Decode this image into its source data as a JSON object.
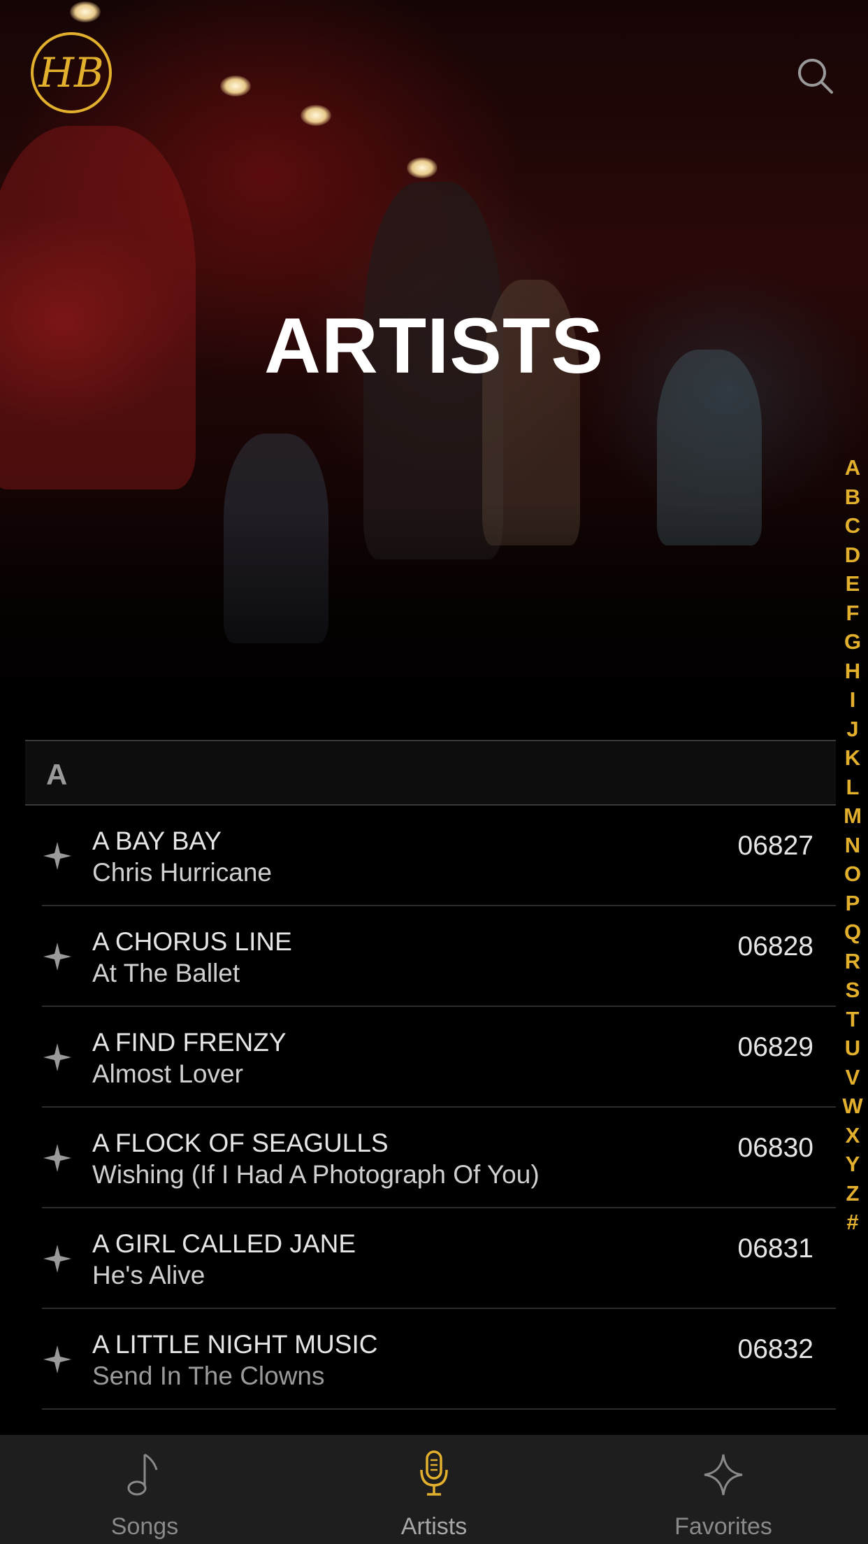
{
  "header": {
    "logo_text": "HB",
    "title": "ARTISTS"
  },
  "section": {
    "letter": "A"
  },
  "rows": [
    {
      "artist": "A BAY BAY",
      "song": "Chris Hurricane",
      "number": "06827"
    },
    {
      "artist": "A CHORUS LINE",
      "song": "At The Ballet",
      "number": "06828"
    },
    {
      "artist": "A FIND FRENZY",
      "song": "Almost Lover",
      "number": "06829"
    },
    {
      "artist": "A FLOCK OF SEAGULLS",
      "song": "Wishing (If I Had A Photograph Of You)",
      "number": "06830"
    },
    {
      "artist": "A GIRL CALLED JANE",
      "song": "He's Alive",
      "number": "06831"
    },
    {
      "artist": "A LITTLE NIGHT MUSIC",
      "song": "Send In The Clowns",
      "number": "06832"
    }
  ],
  "alphabet": [
    "A",
    "B",
    "C",
    "D",
    "E",
    "F",
    "G",
    "H",
    "I",
    "J",
    "K",
    "L",
    "M",
    "N",
    "O",
    "P",
    "Q",
    "R",
    "S",
    "T",
    "U",
    "V",
    "W",
    "X",
    "Y",
    "Z",
    "#"
  ],
  "tabs": [
    {
      "label": "Songs",
      "icon": "music-note-icon",
      "active": false
    },
    {
      "label": "Artists",
      "icon": "microphone-icon",
      "active": true
    },
    {
      "label": "Favorites",
      "icon": "star-icon",
      "active": false
    }
  ],
  "colors": {
    "accent": "#e3b02e",
    "background": "#000000",
    "tabbar": "#1e1e1e"
  }
}
